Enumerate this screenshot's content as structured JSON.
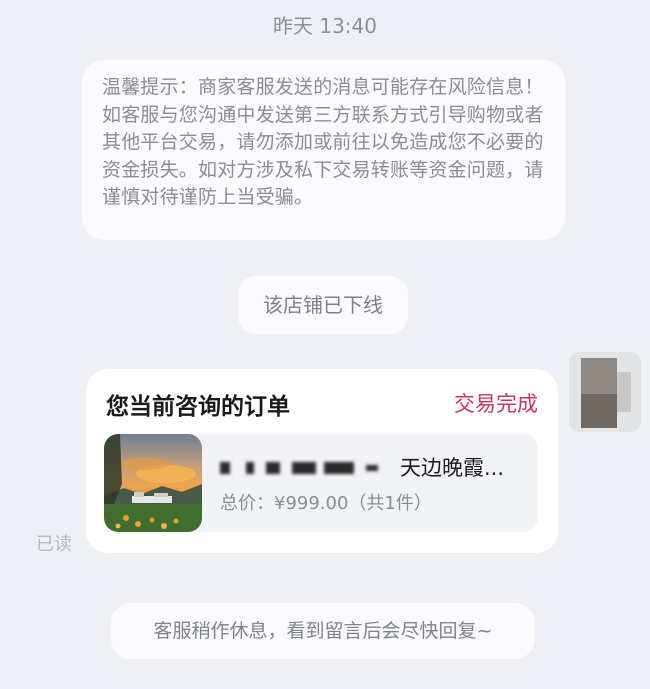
{
  "chat": {
    "timestamp": "昨天 13:40",
    "warning_text": "温馨提示：商家客服发送的消息可能存在风险信息！如客服与您沟通中发送第三方联系方式引导购物或者其他平台交易，请勿添加或前往以免造成您不必要的资金损失。如对方涉及私下交易转账等资金问题，请谨慎对待谨防上当受骗。",
    "store_status": "该店铺已下线",
    "read_status": "已读",
    "auto_reply": "客服稍作休息，看到留言后会尽快回复~"
  },
  "order_card": {
    "title": "您当前咨询的订单",
    "status": "交易完成",
    "status_color": "#c6395a",
    "product": {
      "name": "天边晚霞...",
      "price": "总价：¥999.00（共1件）",
      "thumbnail_icon": "sunset-landscape-image"
    }
  }
}
